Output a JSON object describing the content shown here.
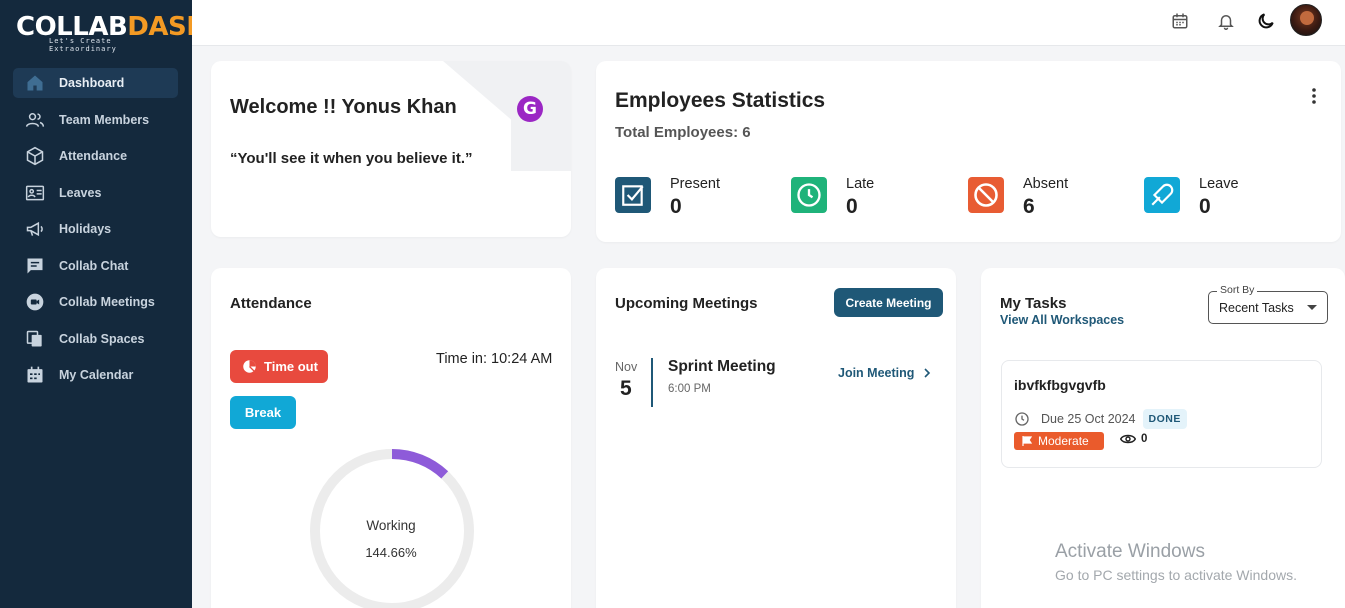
{
  "app": {
    "logo_text_light": "COLLAB",
    "logo_text_accent": "DASH",
    "logo_tagline": "Let's Create Extraordinary",
    "brand_color": "#14293d",
    "accent_color": "#1f5877"
  },
  "sidebar": {
    "items": [
      {
        "label": "Dashboard",
        "icon": "home-icon",
        "active": true
      },
      {
        "label": "Team Members",
        "icon": "team-icon",
        "active": false
      },
      {
        "label": "Attendance",
        "icon": "cube-icon",
        "active": false
      },
      {
        "label": "Leaves",
        "icon": "leave-board-icon",
        "active": false
      },
      {
        "label": "Holidays",
        "icon": "megaphone-icon",
        "active": false
      },
      {
        "label": "Collab Chat",
        "icon": "chat-icon",
        "active": false
      },
      {
        "label": "Collab Meetings",
        "icon": "video-icon",
        "active": false
      },
      {
        "label": "Collab Spaces",
        "icon": "copy-icon",
        "active": false
      },
      {
        "label": "My Calendar",
        "icon": "calendar-icon",
        "active": false
      }
    ]
  },
  "topbar": {
    "icons": [
      "calendar-icon",
      "bell-icon",
      "dark-mode-icon"
    ]
  },
  "welcome": {
    "title": "Welcome !! Yonus Khan",
    "quote": "“You'll see it when you believe it.”",
    "badge_letter": "G"
  },
  "stats": {
    "title": "Employees Statistics",
    "total": "Total Employees: 6",
    "items": [
      {
        "label": "Present",
        "value": "0",
        "color": "#1f5877",
        "icon": "checkbox-icon"
      },
      {
        "label": "Late",
        "value": "0",
        "color": "#1fb37a",
        "icon": "clock-icon"
      },
      {
        "label": "Absent",
        "value": "6",
        "color": "#e85c33",
        "icon": "block-icon"
      },
      {
        "label": "Leave",
        "value": "0",
        "color": "#11a8d6",
        "icon": "plane-icon"
      }
    ]
  },
  "attendance": {
    "title": "Attendance",
    "timeout_label": "Time out",
    "break_label": "Break",
    "time_in": "Time in: 10:24 AM",
    "gauge_label": "Working",
    "gauge_value": "144.66%",
    "gauge_arc_fraction": 0.12,
    "gauge_color": "#8e5bd9"
  },
  "meetings": {
    "title": "Upcoming Meetings",
    "create_label": "Create Meeting",
    "items": [
      {
        "month": "Nov",
        "day": "5",
        "name": "Sprint Meeting",
        "time": "6:00 PM",
        "join_label": "Join Meeting"
      }
    ]
  },
  "tasks": {
    "title": "My Tasks",
    "view_all": "View All Workspaces",
    "sort_legend": "Sort By",
    "sort_value": "Recent Tasks",
    "items": [
      {
        "name": "ibvfkfbgvgvfb",
        "due": "Due 25 Oct 2024",
        "status": "DONE",
        "priority": "Moderate",
        "views": "0"
      }
    ]
  },
  "overlay": {
    "activate_title": "Activate Windows",
    "activate_sub": "Go to PC settings to activate Windows."
  }
}
